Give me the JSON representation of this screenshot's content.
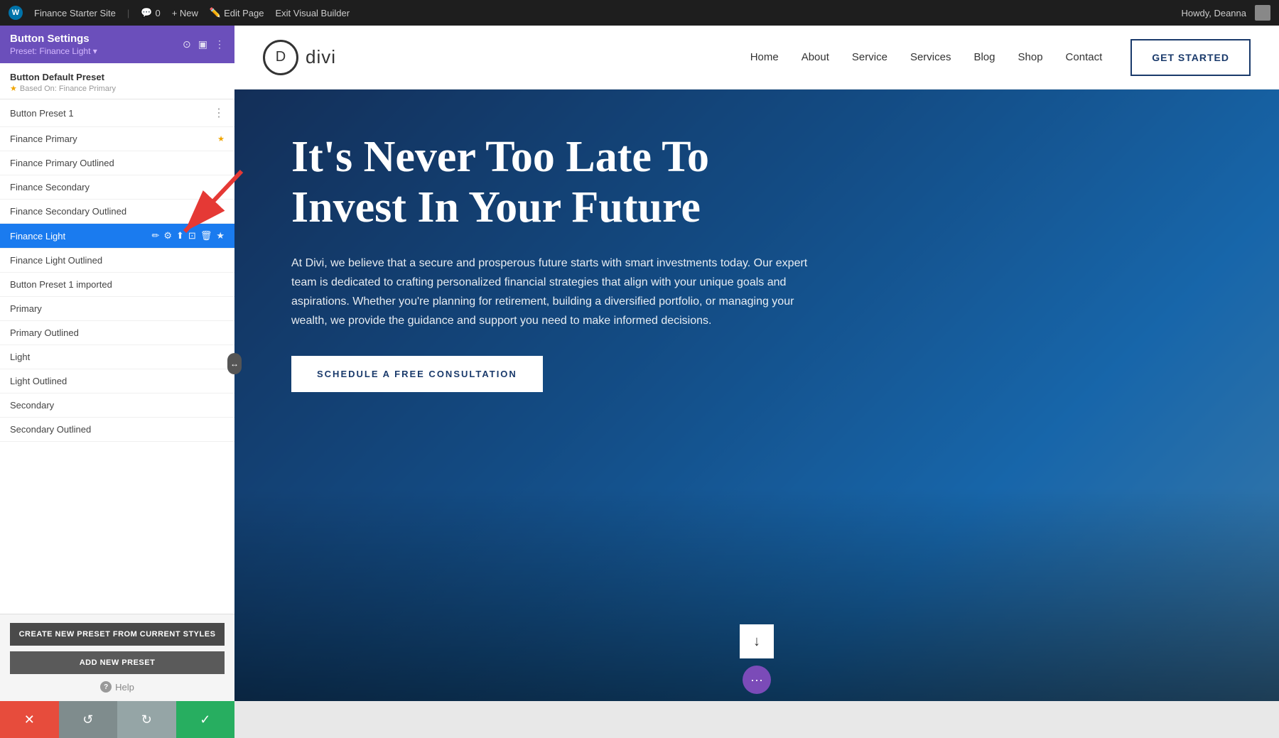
{
  "adminBar": {
    "siteName": "Finance Starter Site",
    "comments": "0",
    "newLabel": "+ New",
    "editPage": "Edit Page",
    "exitBuilder": "Exit Visual Builder",
    "howdy": "Howdy, Deanna"
  },
  "panel": {
    "title": "Button Settings",
    "preset": "Preset: Finance Light ▾",
    "defaultPreset": {
      "label": "Button Default Preset",
      "basedOn": "Based On: Finance Primary"
    },
    "presets": [
      {
        "id": 1,
        "name": "Button Preset 1",
        "active": false,
        "hasDots": true
      },
      {
        "id": 2,
        "name": "Finance Primary",
        "active": false,
        "hasStar": true
      },
      {
        "id": 3,
        "name": "Finance Primary Outlined",
        "active": false
      },
      {
        "id": 4,
        "name": "Finance Secondary",
        "active": false
      },
      {
        "id": 5,
        "name": "Finance Secondary Outlined",
        "active": false
      },
      {
        "id": 6,
        "name": "Finance Light",
        "active": true
      },
      {
        "id": 7,
        "name": "Finance Light Outlined",
        "active": false
      },
      {
        "id": 8,
        "name": "Button Preset 1 imported",
        "active": false
      },
      {
        "id": 9,
        "name": "Primary",
        "active": false
      },
      {
        "id": 10,
        "name": "Primary Outlined",
        "active": false
      },
      {
        "id": 11,
        "name": "Light",
        "active": false
      },
      {
        "id": 12,
        "name": "Light Outlined",
        "active": false
      },
      {
        "id": 13,
        "name": "Secondary",
        "active": false
      },
      {
        "id": 14,
        "name": "Secondary Outlined",
        "active": false
      }
    ],
    "createPresetBtn": "CREATE NEW PRESET FROM CURRENT STYLES",
    "addPresetBtn": "ADD NEW PRESET",
    "helpLabel": "Help"
  },
  "toolbar": {
    "cancelIcon": "✕",
    "undoIcon": "↺",
    "redoIcon": "↻",
    "checkIcon": "✓"
  },
  "siteNav": {
    "logoLetter": "D",
    "logoText": "divi",
    "links": [
      "Home",
      "About",
      "Service",
      "Services",
      "Blog",
      "Shop",
      "Contact"
    ],
    "ctaLabel": "GET STARTED"
  },
  "hero": {
    "title": "It's Never Too Late To Invest In Your Future",
    "subtitle": "At Divi, we believe that a secure and prosperous future starts with smart investments today. Our expert team is dedicated to crafting personalized financial strategies that align with your unique goals and aspirations. Whether you're planning for retirement, building a diversified portfolio, or managing your wealth, we provide the guidance and support you need to make informed decisions.",
    "ctaLabel": "SCHEDULE A FREE CONSULTATION",
    "scrollDownIcon": "↓",
    "diviDots": "···"
  }
}
